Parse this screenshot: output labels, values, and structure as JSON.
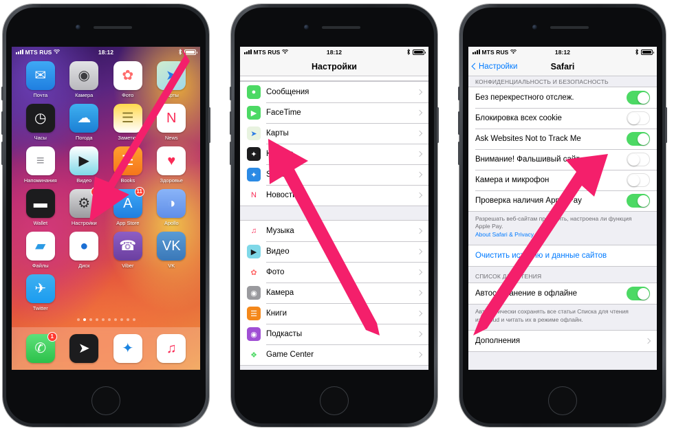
{
  "status_bar": {
    "carrier": "MTS RUS",
    "time": "18:12",
    "signal_icon": "signal-bars-icon",
    "wifi_icon": "wifi-icon",
    "bluetooth_icon": "bluetooth-icon",
    "battery_icon": "battery-icon"
  },
  "phone1": {
    "name": "home-screen",
    "apps": [
      {
        "name": "Почта",
        "icon": "mail-icon",
        "glyph": "✉",
        "bg": "linear-gradient(180deg,#3fa9f5,#1f7fe0)",
        "fg": "#ffffff",
        "badge": ""
      },
      {
        "name": "Камера",
        "icon": "camera-icon",
        "glyph": "◉",
        "bg": "linear-gradient(180deg,#e3e3e5,#b9b9bd)",
        "fg": "#3c3c40",
        "badge": ""
      },
      {
        "name": "Фото",
        "icon": "photos-icon",
        "glyph": "✿",
        "bg": "#ffffff",
        "fg": "#ff6b6b",
        "badge": ""
      },
      {
        "name": "Карты",
        "icon": "maps-icon",
        "glyph": "➤",
        "bg": "linear-gradient(150deg,#cfeccf,#9fd8ea)",
        "fg": "#2b7be4",
        "badge": ""
      },
      {
        "name": "Часы",
        "icon": "clock-icon",
        "glyph": "◷",
        "bg": "#1c1c1e",
        "fg": "#ffffff",
        "badge": ""
      },
      {
        "name": "Погода",
        "icon": "weather-icon",
        "glyph": "☁",
        "bg": "linear-gradient(180deg,#3fb0f0,#1b7fd4)",
        "fg": "#ffffff",
        "badge": ""
      },
      {
        "name": "Заметки",
        "icon": "notes-icon",
        "glyph": "☰",
        "bg": "linear-gradient(180deg,#ffd84d,#ffffff)",
        "fg": "#8a7a30",
        "badge": ""
      },
      {
        "name": "News",
        "icon": "news-icon",
        "glyph": "N",
        "bg": "#ffffff",
        "fg": "#fa2b56",
        "badge": ""
      },
      {
        "name": "Напоминания",
        "icon": "reminders-icon",
        "glyph": "≡",
        "bg": "#ffffff",
        "fg": "#8e8e93",
        "badge": ""
      },
      {
        "name": "Видео",
        "icon": "videos-icon",
        "glyph": "▶",
        "bg": "linear-gradient(180deg,#ffffff,#7fd8e8)",
        "fg": "#1c1c1e",
        "badge": ""
      },
      {
        "name": "Books",
        "icon": "books-icon",
        "glyph": "☰",
        "bg": "linear-gradient(180deg,#ff9f2e,#f4761b)",
        "fg": "#ffffff",
        "badge": ""
      },
      {
        "name": "Здоровье",
        "icon": "health-icon",
        "glyph": "♥",
        "bg": "#ffffff",
        "fg": "#fa2b56",
        "badge": ""
      },
      {
        "name": "Wallet",
        "icon": "wallet-icon",
        "glyph": "▬",
        "bg": "#1c1c1e",
        "fg": "#ffffff",
        "badge": ""
      },
      {
        "name": "Настройки",
        "icon": "settings-gear-icon",
        "glyph": "⚙",
        "bg": "linear-gradient(180deg,#dcdcde,#9a9a9e)",
        "fg": "#2c2c2e",
        "badge": "1"
      },
      {
        "name": "App Store",
        "icon": "app-store-icon",
        "glyph": "A",
        "bg": "linear-gradient(180deg,#3fa9f5,#1f7fe0)",
        "fg": "#ffffff",
        "badge": "11"
      },
      {
        "name": "Apollo",
        "icon": "apollo-icon",
        "glyph": "◑",
        "bg": "linear-gradient(180deg,#8ab4f8,#5f8ee8)",
        "fg": "#ffffff",
        "badge": ""
      },
      {
        "name": "Файлы",
        "icon": "files-icon",
        "glyph": "▰",
        "bg": "#ffffff",
        "fg": "#2b9ae4",
        "badge": ""
      },
      {
        "name": "Диск",
        "icon": "disk-icon",
        "glyph": "●",
        "bg": "#ffffff",
        "fg": "#1b6fd4",
        "badge": ""
      },
      {
        "name": "Viber",
        "icon": "viber-icon",
        "glyph": "☎",
        "bg": "linear-gradient(180deg,#8e5ec4,#6b3fa0)",
        "fg": "#ffffff",
        "badge": ""
      },
      {
        "name": "VK",
        "icon": "vk-icon",
        "glyph": "VK",
        "bg": "linear-gradient(180deg,#5a9bd4,#3a78b8)",
        "fg": "#ffffff",
        "badge": ""
      },
      {
        "name": "Twitter",
        "icon": "twitter-icon",
        "glyph": "✈",
        "bg": "linear-gradient(180deg,#3fb0f0,#1b9cf0)",
        "fg": "#ffffff",
        "badge": ""
      }
    ],
    "page_dots": {
      "count": 10,
      "active_index": 1
    },
    "dock": [
      {
        "name": "Телефон",
        "icon": "phone-icon",
        "glyph": "✆",
        "bg": "linear-gradient(180deg,#5ee07a,#2cc14a)",
        "fg": "#ffffff",
        "badge": "1"
      },
      {
        "name": "Telegram",
        "icon": "telegram-icon",
        "glyph": "➤",
        "bg": "#1c1c1e",
        "fg": "#ffffff",
        "badge": ""
      },
      {
        "name": "Safari",
        "icon": "safari-icon",
        "glyph": "✦",
        "bg": "#ffffff",
        "fg": "#1b84e0",
        "badge": ""
      },
      {
        "name": "Музыка",
        "icon": "music-icon",
        "glyph": "♫",
        "bg": "#ffffff",
        "fg": "#fa2b56",
        "badge": ""
      }
    ]
  },
  "phone2": {
    "name": "settings-screen",
    "title": "Настройки",
    "groups": [
      {
        "rows": [
          {
            "label": "Сообщения",
            "icon": "messages-icon",
            "glyph": "●",
            "bg": "#4cd964",
            "fg": "#ffffff"
          },
          {
            "label": "FaceTime",
            "icon": "facetime-icon",
            "glyph": "▶",
            "bg": "#4cd964",
            "fg": "#ffffff"
          },
          {
            "label": "Карты",
            "icon": "maps-icon",
            "glyph": "➤",
            "bg": "#e8f3e0",
            "fg": "#2b7be4"
          },
          {
            "label": "Компас",
            "icon": "compass-icon",
            "glyph": "✦",
            "bg": "#1c1c1e",
            "fg": "#ffffff"
          },
          {
            "label": "Safari",
            "icon": "safari-icon",
            "glyph": "✦",
            "bg": "#2b8ae4",
            "fg": "#ffffff"
          },
          {
            "label": "Новости",
            "icon": "news-icon",
            "glyph": "N",
            "bg": "#ffffff",
            "fg": "#fa2b56"
          }
        ]
      },
      {
        "rows": [
          {
            "label": "Музыка",
            "icon": "music-icon",
            "glyph": "♫",
            "bg": "#ffffff",
            "fg": "#fa2b56"
          },
          {
            "label": "Видео",
            "icon": "videos-icon",
            "glyph": "▶",
            "bg": "#7fd8e8",
            "fg": "#1c1c1e"
          },
          {
            "label": "Фото",
            "icon": "photos-icon",
            "glyph": "✿",
            "bg": "#ffffff",
            "fg": "#ff6b6b"
          },
          {
            "label": "Камера",
            "icon": "camera-icon",
            "glyph": "◉",
            "bg": "#9a9a9e",
            "fg": "#ffffff"
          },
          {
            "label": "Книги",
            "icon": "books-icon",
            "glyph": "☰",
            "bg": "#f4881b",
            "fg": "#ffffff"
          },
          {
            "label": "Подкасты",
            "icon": "podcasts-icon",
            "glyph": "◉",
            "bg": "#a04fd4",
            "fg": "#ffffff"
          },
          {
            "label": "Game Center",
            "icon": "game-center-icon",
            "glyph": "❖",
            "bg": "#ffffff",
            "fg": "#4cd964"
          }
        ]
      }
    ]
  },
  "phone3": {
    "name": "safari-settings-screen",
    "back_label": "Настройки",
    "title": "Safari",
    "section1_header": "КОНФИДЕНЦИАЛЬНОСТЬ И БЕЗОПАСНОСТЬ",
    "toggles": [
      {
        "label": "Без перекрестного отслеж.",
        "state": "on"
      },
      {
        "label": "Блокировка всех cookie",
        "state": "off"
      },
      {
        "label": "Ask Websites Not to Track Me",
        "state": "on"
      },
      {
        "label": "Внимание! Фальшивый сайт",
        "state": "off"
      },
      {
        "label": "Камера и микрофон",
        "state": "off"
      },
      {
        "label": "Проверка наличия Apple Pay",
        "state": "on"
      }
    ],
    "footer1_line1": "Разрешать веб-сайтам проверять, настроена ли функция",
    "footer1_line2": "Apple Pay.",
    "footer1_link": "About Safari & Privacy.",
    "clear_label": "Очистить историю и данные сайтов",
    "section2_header": "СПИСОК ДЛЯ ЧТЕНИЯ",
    "reading_toggle": {
      "label": "Автосохранение в офлайне",
      "state": "on"
    },
    "footer2_line1": "Автоматически сохранять все статьи Списка для чтения",
    "footer2_line2": "из iCloud и читать их в режиме офлайн.",
    "extras_label": "Дополнения"
  },
  "annotations": {
    "arrow_color": "#f41f6b",
    "arrows": [
      {
        "name": "arrow-to-settings-app",
        "from": "top-right",
        "to": "settings-icon"
      },
      {
        "name": "arrow-to-safari-row",
        "from": "bottom-right",
        "to": "safari-row"
      },
      {
        "name": "arrow-to-fraud-toggle",
        "from": "bottom-left",
        "to": "fraudulent-site-toggle"
      }
    ]
  }
}
